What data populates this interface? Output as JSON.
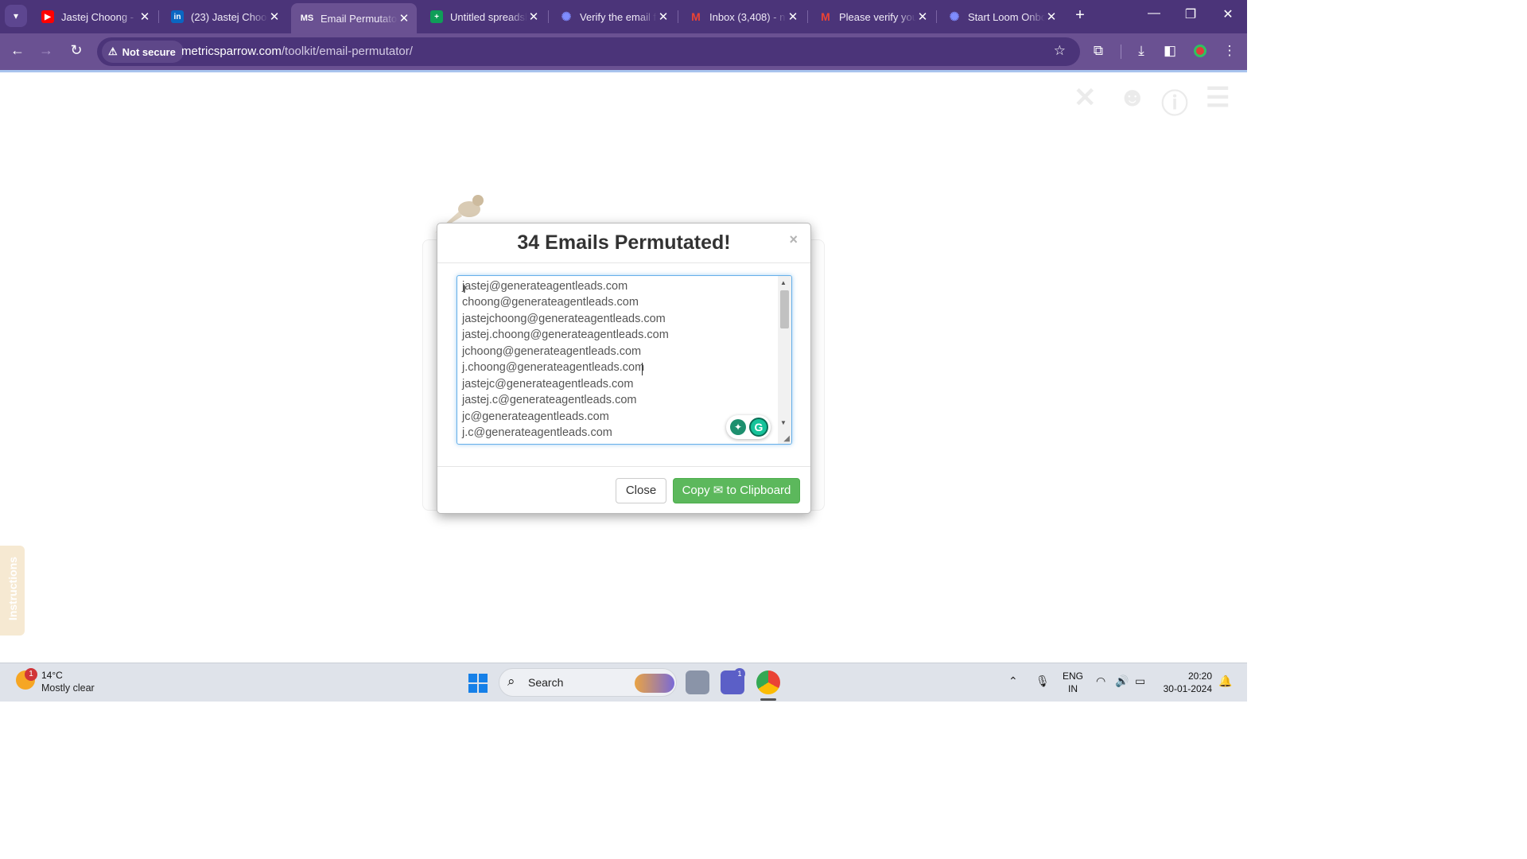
{
  "browser": {
    "tabs": [
      {
        "title": "Jastej Choong - ",
        "favicon": "youtube-icon",
        "color": "#ff0000",
        "active": false
      },
      {
        "title": "(23) Jastej Choon",
        "favicon": "linkedin-icon",
        "color": "#0a66c2",
        "active": false
      },
      {
        "title": "Email Permutator",
        "favicon": "ms-icon",
        "color": "#ffffff",
        "active": true
      },
      {
        "title": "Untitled spreadsh",
        "favicon": "sheets-icon",
        "color": "#0f9d58",
        "active": false
      },
      {
        "title": "Verify the email f",
        "favicon": "gear-flower-icon",
        "color": "#5b6cf0",
        "active": false
      },
      {
        "title": "Inbox (3,408) - n",
        "favicon": "gmail-icon",
        "color": "#ea4335",
        "active": false
      },
      {
        "title": "Please verify you",
        "favicon": "gmail-icon",
        "color": "#ea4335",
        "active": false
      },
      {
        "title": "Start Loom Onbo",
        "favicon": "loom-icon",
        "color": "#625df5",
        "active": false
      }
    ],
    "security_label": "Not secure",
    "url_host": "metricsparrow.com",
    "url_path": "/toolkit/email-permutator/"
  },
  "page": {
    "instructions_tab": "Instructions"
  },
  "modal": {
    "title": "34 Emails Permutated!",
    "close_x": "×",
    "emails": [
      "jastej@generateagentleads.com",
      "choong@generateagentleads.com",
      "jastejchoong@generateagentleads.com",
      "jastej.choong@generateagentleads.com",
      "jchoong@generateagentleads.com",
      "j.choong@generateagentleads.com",
      "jastejc@generateagentleads.com",
      "jastej.c@generateagentleads.com",
      "jc@generateagentleads.com",
      "j.c@generateagentleads.com"
    ],
    "close_button": "Close",
    "copy_button": "Copy ✉ to Clipboard"
  },
  "taskbar": {
    "weather_badge": "1",
    "temperature": "14°C",
    "condition": "Mostly clear",
    "search_label": "Search",
    "teams_badge": "1",
    "lang_line1": "ENG",
    "lang_line2": "IN",
    "time": "20:20",
    "date": "30-01-2024"
  }
}
